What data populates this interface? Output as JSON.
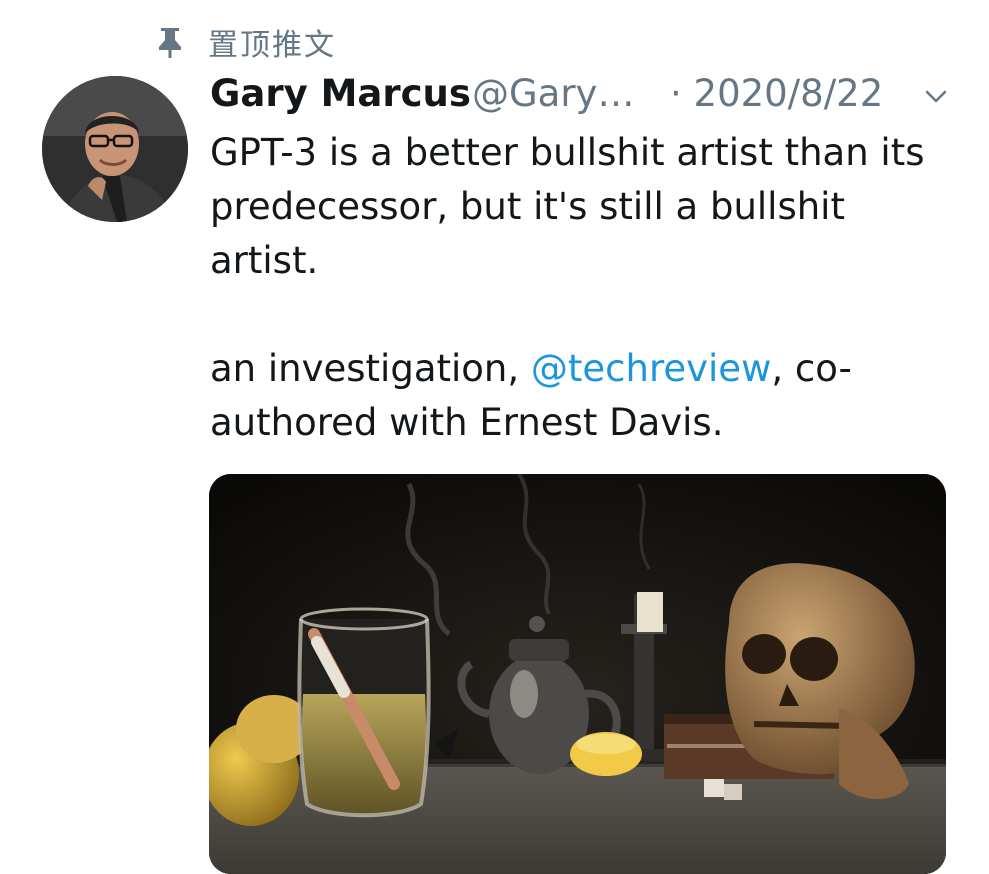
{
  "pinned": {
    "icon": "pin-icon",
    "label": "置顶推文"
  },
  "author": {
    "avatar_icon": "avatar",
    "name": "Gary Marcus",
    "handle": "@Gary…",
    "date": "· 2020/8/22"
  },
  "menu": {
    "icon": "chevron-down-icon"
  },
  "tweet": {
    "line1": "GPT-3 is a better bullshit artist than its",
    "line2": "predecessor, but it's still a bullshit",
    "line3": "artist.",
    "line4_prefix": "an investigation, ",
    "mention": "@techreview",
    "line4_suffix": ", co-",
    "line5": "authored with Ernest Davis."
  },
  "colors": {
    "link": "#1b95e0",
    "secondary": "#657786",
    "text": "#14171a"
  }
}
